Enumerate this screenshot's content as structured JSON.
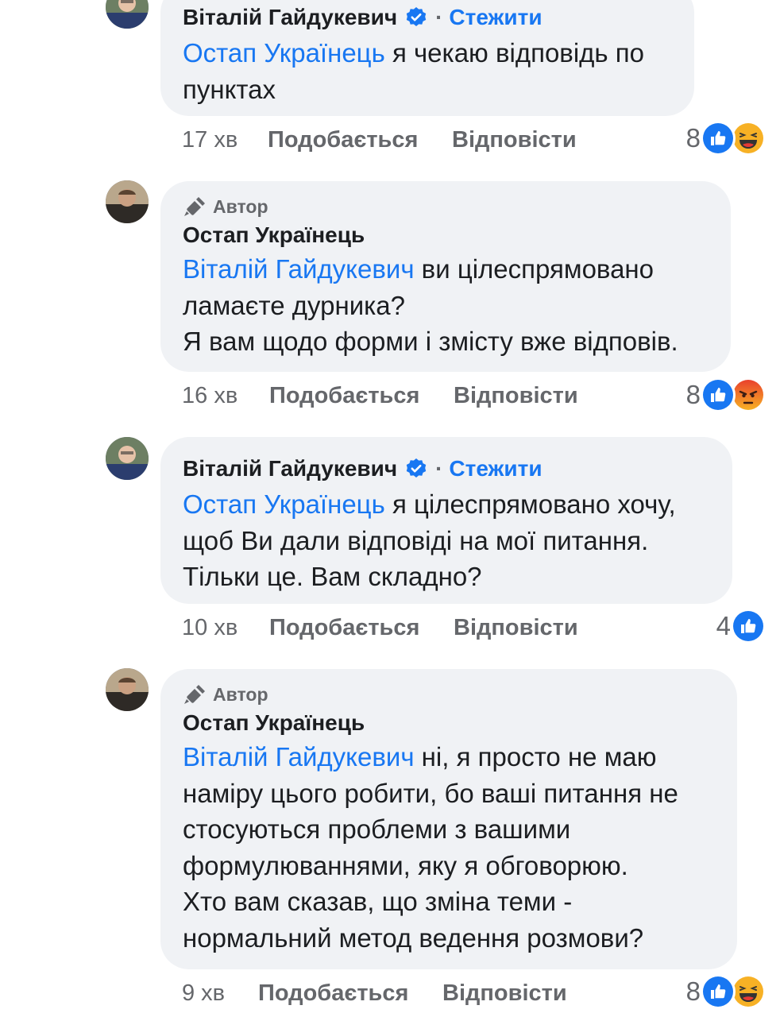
{
  "comments": [
    {
      "author": "Віталій Гайдукевич",
      "is_author": false,
      "verified": true,
      "follow_label": "Стежити",
      "mention": "Остап Українець",
      "lines": [
        " я чекаю відповідь по",
        "пунктах"
      ],
      "time": "17 хв",
      "like_label": "Подобається",
      "reply_label": "Відповісти",
      "reaction_count": "8",
      "reactions": [
        "like-reaction-icon",
        "haha-reaction-icon"
      ]
    },
    {
      "author_badge": "Автор",
      "author": "Остап Українець",
      "is_author": true,
      "mention": "Віталій Гайдукевич",
      "lines": [
        " ви цілеспрямовано",
        "ламаєте дурника?",
        "Я вам щодо форми і змісту вже відповів."
      ],
      "time": "16 хв",
      "like_label": "Подобається",
      "reply_label": "Відповісти",
      "reaction_count": "8",
      "reactions": [
        "like-reaction-icon",
        "angry-reaction-icon"
      ]
    },
    {
      "author": "Віталій Гайдукевич",
      "is_author": false,
      "verified": true,
      "follow_label": "Стежити",
      "mention": "Остап Українець",
      "lines": [
        " я цілеспрямовано хочу,",
        "щоб Ви дали відповіді на мої питання.",
        "Тільки це. Вам складно?"
      ],
      "time": "10 хв",
      "like_label": "Подобається",
      "reply_label": "Відповісти",
      "reaction_count": "4",
      "reactions": [
        "like-reaction-icon"
      ]
    },
    {
      "author_badge": "Автор",
      "author": "Остап Українець",
      "is_author": true,
      "mention": "Віталій Гайдукевич",
      "lines": [
        " ні, я просто не маю",
        "наміру цього робити, бо ваші питання не",
        "стосуються проблеми з вашими",
        "формулюваннями, яку я обговорюю.",
        "Хто вам сказав, що зміна теми -",
        "нормальний метод ведення розмови?"
      ],
      "time": "9 хв",
      "like_label": "Подобається",
      "reply_label": "Відповісти",
      "reaction_count": "8",
      "reactions": [
        "like-reaction-icon",
        "haha-reaction-icon"
      ]
    }
  ],
  "colors": {
    "bubble": "#f0f2f5",
    "link": "#1877f2",
    "secondary_text": "#65676b",
    "like": "#1877f2",
    "haha": "#f7b125",
    "angry": "#e9710f"
  }
}
